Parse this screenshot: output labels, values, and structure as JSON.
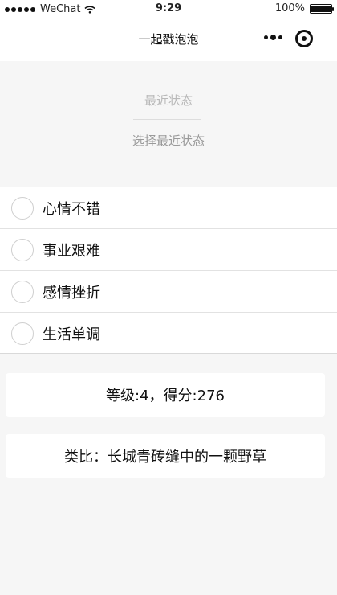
{
  "status_bar": {
    "carrier": "WeChat",
    "time": "9:29",
    "battery_percent": "100%"
  },
  "titlebar": {
    "title": "一起戳泡泡"
  },
  "recent": {
    "title": "最近状态",
    "subtitle": "选择最近状态"
  },
  "options": [
    {
      "label": "心情不错",
      "selected": false
    },
    {
      "label": "事业艰难",
      "selected": false
    },
    {
      "label": "感情挫折",
      "selected": false
    },
    {
      "label": "生活单调",
      "selected": false
    }
  ],
  "result": {
    "score_text": "等级:4，得分:276",
    "analogy_text": "类比：长城青砖缝中的一颗野草"
  },
  "icons": {
    "signal": "signal-dots-icon",
    "wifi": "wifi-icon",
    "battery": "battery-icon",
    "more": "more-dots-icon",
    "close": "record-target-icon"
  },
  "colors": {
    "background": "#f6f6f6",
    "surface": "#ffffff",
    "muted_text": "#b9b9b9",
    "secondary_text": "#9a9a9a"
  }
}
